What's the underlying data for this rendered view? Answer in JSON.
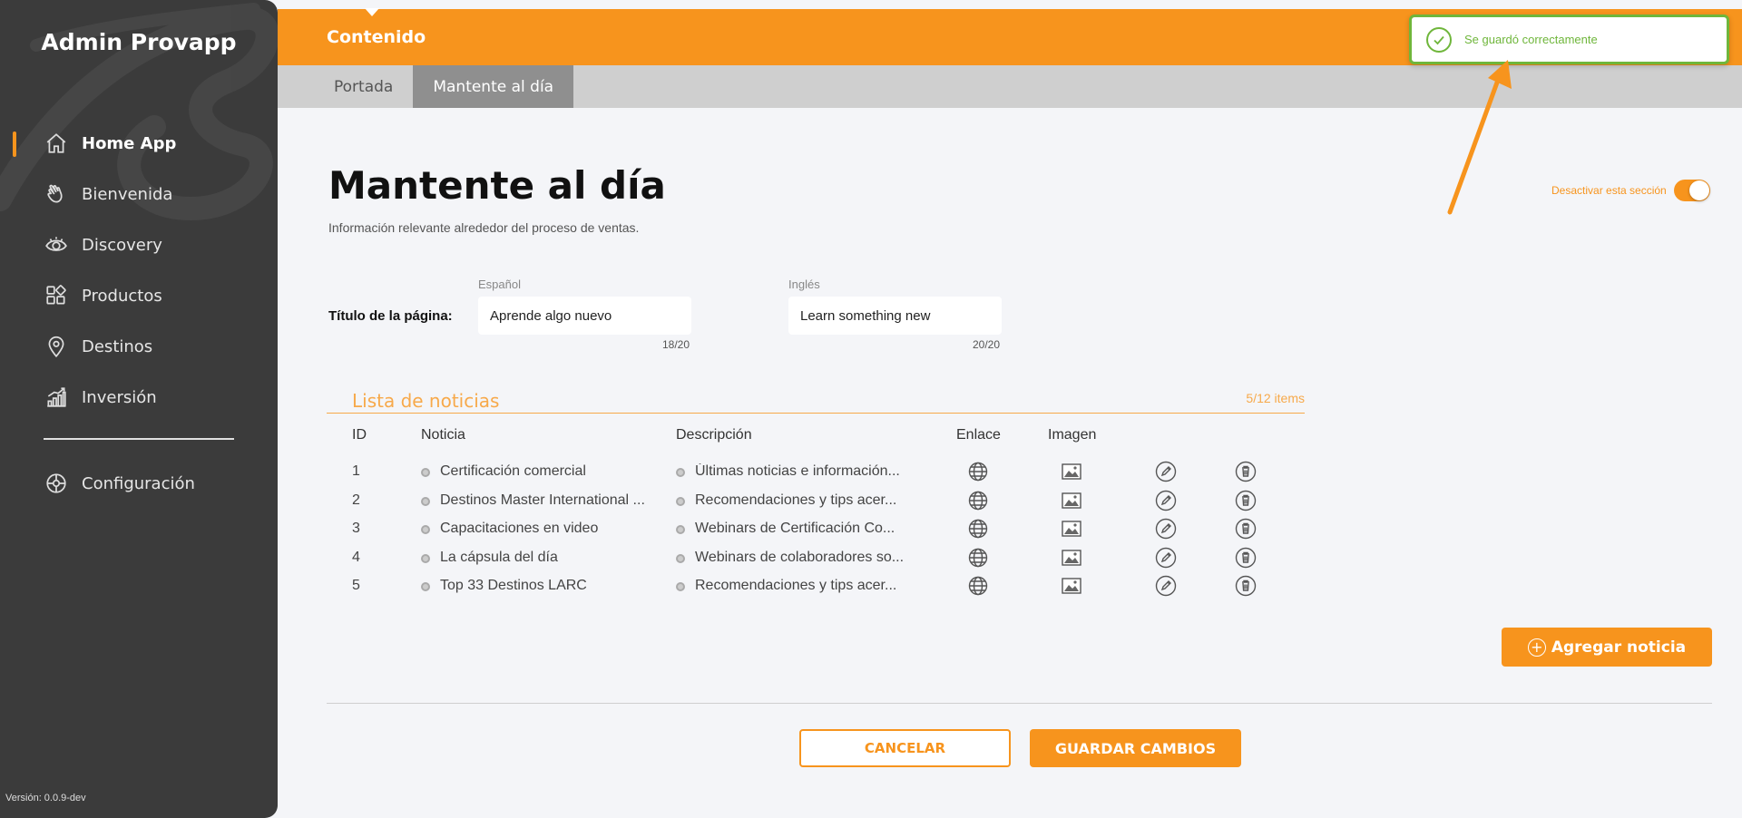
{
  "app": {
    "brand": "Admin Provapp",
    "version": "Versión: 0.0.9-dev"
  },
  "sidebar": {
    "items": [
      {
        "label": "Home App",
        "icon": "home-icon",
        "active": true
      },
      {
        "label": "Bienvenida",
        "icon": "waving-hand-icon",
        "active": false
      },
      {
        "label": "Discovery",
        "icon": "eye-icon",
        "active": false
      },
      {
        "label": "Productos",
        "icon": "grid-icon",
        "active": false
      },
      {
        "label": "Destinos",
        "icon": "map-pin-icon",
        "active": false
      },
      {
        "label": "Inversión",
        "icon": "growth-chart-icon",
        "active": false
      }
    ],
    "config": {
      "label": "Configuración",
      "icon": "settings-icon"
    }
  },
  "header": {
    "title": "Contenido"
  },
  "tabs": [
    {
      "label": "Portada",
      "active": false
    },
    {
      "label": "Mantente al día",
      "active": true
    }
  ],
  "toast": {
    "message": "Se guardó correctamente",
    "color": "#6fb63b"
  },
  "page": {
    "title": "Mantente al día",
    "subtitle": "Información relevante alrededor del proceso de ventas.",
    "toggle_label": "Desactivar esta sección",
    "toggle_on": true
  },
  "page_title_field": {
    "label": "Título de la página:",
    "spanish": {
      "lang": "Español",
      "value": "Aprende algo nuevo",
      "counter": "18/20"
    },
    "english": {
      "lang": "Inglés",
      "value": "Learn something new",
      "counter": "20/20"
    }
  },
  "news": {
    "title": "Lista de noticias",
    "count": "5/12 items",
    "columns": {
      "id": "ID",
      "noticia": "Noticia",
      "descripcion": "Descripción",
      "enlace": "Enlace",
      "imagen": "Imagen"
    },
    "rows": [
      {
        "id": "1",
        "noticia": "Certificación comercial",
        "descripcion": "Últimas noticias e información..."
      },
      {
        "id": "2",
        "noticia": "Destinos Master International ...",
        "descripcion": "Recomendaciones y tips acer..."
      },
      {
        "id": "3",
        "noticia": "Capacitaciones en video",
        "descripcion": "Webinars de Certificación Co..."
      },
      {
        "id": "4",
        "noticia": "La cápsula del día",
        "descripcion": "Webinars de colaboradores so..."
      },
      {
        "id": "5",
        "noticia": "Top 33 Destinos LARC",
        "descripcion": "Recomendaciones y tips acer..."
      }
    ]
  },
  "actions": {
    "add": "Agregar noticia",
    "cancel": "CANCELAR",
    "save": "GUARDAR CAMBIOS"
  },
  "colors": {
    "accent": "#f7941d",
    "sidebar": "#3b3b3b",
    "success": "#6fb63b"
  }
}
